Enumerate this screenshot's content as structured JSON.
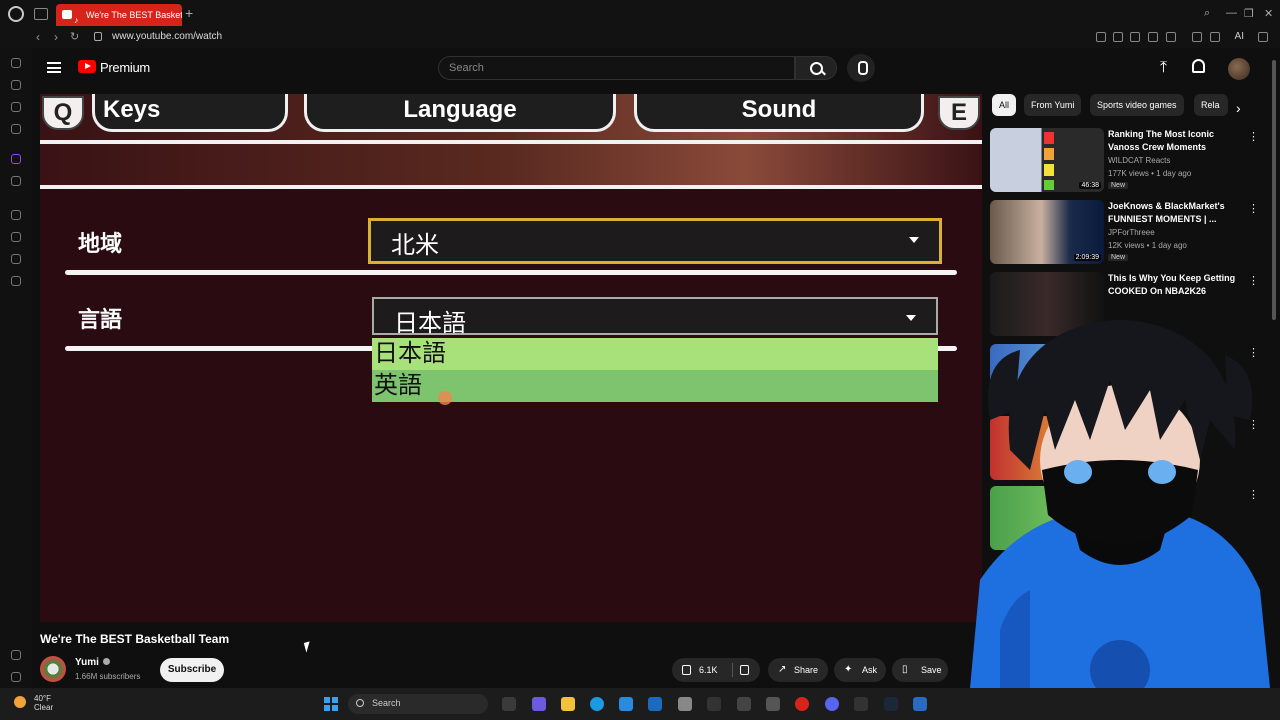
{
  "browser": {
    "tab_title": "We're The BEST Basketball Team",
    "url": "www.youtube.com/watch",
    "ai_label": "AI"
  },
  "header": {
    "brand": "Premium",
    "search_placeholder": "Search"
  },
  "video": {
    "game_menu": {
      "key_left": "Q",
      "tab_keys": "Keys",
      "tab_language": "Language",
      "tab_sound": "Sound",
      "key_right": "E"
    },
    "region_label": "地域",
    "region_value": "北米",
    "language_label": "言語",
    "language_value": "日本語",
    "language_options": [
      "日本語",
      "英語"
    ]
  },
  "info": {
    "title": "We're The BEST Basketball Team",
    "channel": "Yumi",
    "subscribers": "1.66M subscribers",
    "subscribe_label": "Subscribe",
    "likes": "6.1K",
    "share_label": "Share",
    "ask_label": "Ask",
    "save_label": "Save"
  },
  "chips": [
    "All",
    "From Yumi",
    "Sports video games",
    "Rela"
  ],
  "recommendations": [
    {
      "title": "Ranking The Most Iconic Vanoss Crew Moments",
      "channel": "WILDCAT Reacts",
      "meta": "177K views • 1 day ago",
      "badge": "New",
      "duration": "46:38"
    },
    {
      "title": "JoeKnows & BlackMarket's FUNNIEST MOMENTS | ...",
      "channel": "JPForThreee",
      "meta": "12K views • 1 day ago",
      "badge": "New",
      "duration": "2:09:39"
    },
    {
      "title": "This Is Why You Keep Getting COOKED On NBA2K26",
      "channel": "",
      "meta": "",
      "badge": "",
      "duration": ""
    }
  ],
  "taskbar": {
    "temperature": "40°F",
    "condition": "Clear",
    "search_label": "Search"
  },
  "colors": {
    "youtube_red": "#ff0000",
    "tab_red": "#d6241b",
    "dropdown_selected_border": "#d8b232",
    "option_highlight": "#a8e07a"
  }
}
